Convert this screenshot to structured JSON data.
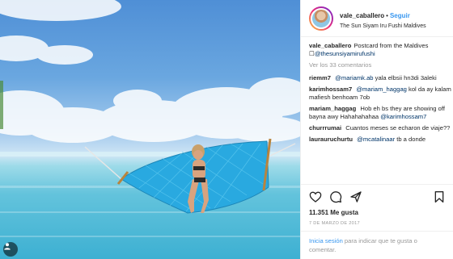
{
  "post": {
    "username": "vale_caballero",
    "separator": "•",
    "follow_label": "Seguir",
    "location": "The Sun Siyam Iru Fushi Maldives",
    "caption_text": "Postcard from the Maldives",
    "caption_emoji": "☐",
    "caption_mention": "@thesunsiyamirufushi",
    "view_all_comments": "Ver los 33 comentarios",
    "likes_count": "11.351",
    "likes_label": "Me gusta",
    "date": "7 DE MARZO DE 2017"
  },
  "comments": [
    {
      "user": "riemm7",
      "mention": "@mariamk.ab",
      "text": "yala elbsii hn3di 3aleki"
    },
    {
      "user": "karimhossam7",
      "mention": "@mariam_haggag",
      "text": "kol da ay kalam mafiesh benhoam 7ob"
    },
    {
      "user": "mariam_haggag",
      "mention": "@karimhossam7",
      "text_before": "Hob eh bs they are showing off bayna awy Hahahahahaa"
    },
    {
      "user": "churrrumai",
      "text": "Cuantos meses se echaron de viaje??"
    },
    {
      "user": "laurauruchurtu",
      "mention": "@mcatalinaar",
      "text": "tb a donde"
    }
  ],
  "login": {
    "link_label": "Inicia sesión",
    "rest_text": "para indicar que te gusta o comentar."
  },
  "icons": {
    "like": "heart-icon",
    "comment": "comment-icon",
    "share": "share-icon",
    "save": "bookmark-icon",
    "photo_badge": "user-tag-icon"
  },
  "colors": {
    "link_blue": "#3897f0",
    "mention_blue": "#003569",
    "muted": "#999999",
    "hammock": "#29a9e0"
  }
}
